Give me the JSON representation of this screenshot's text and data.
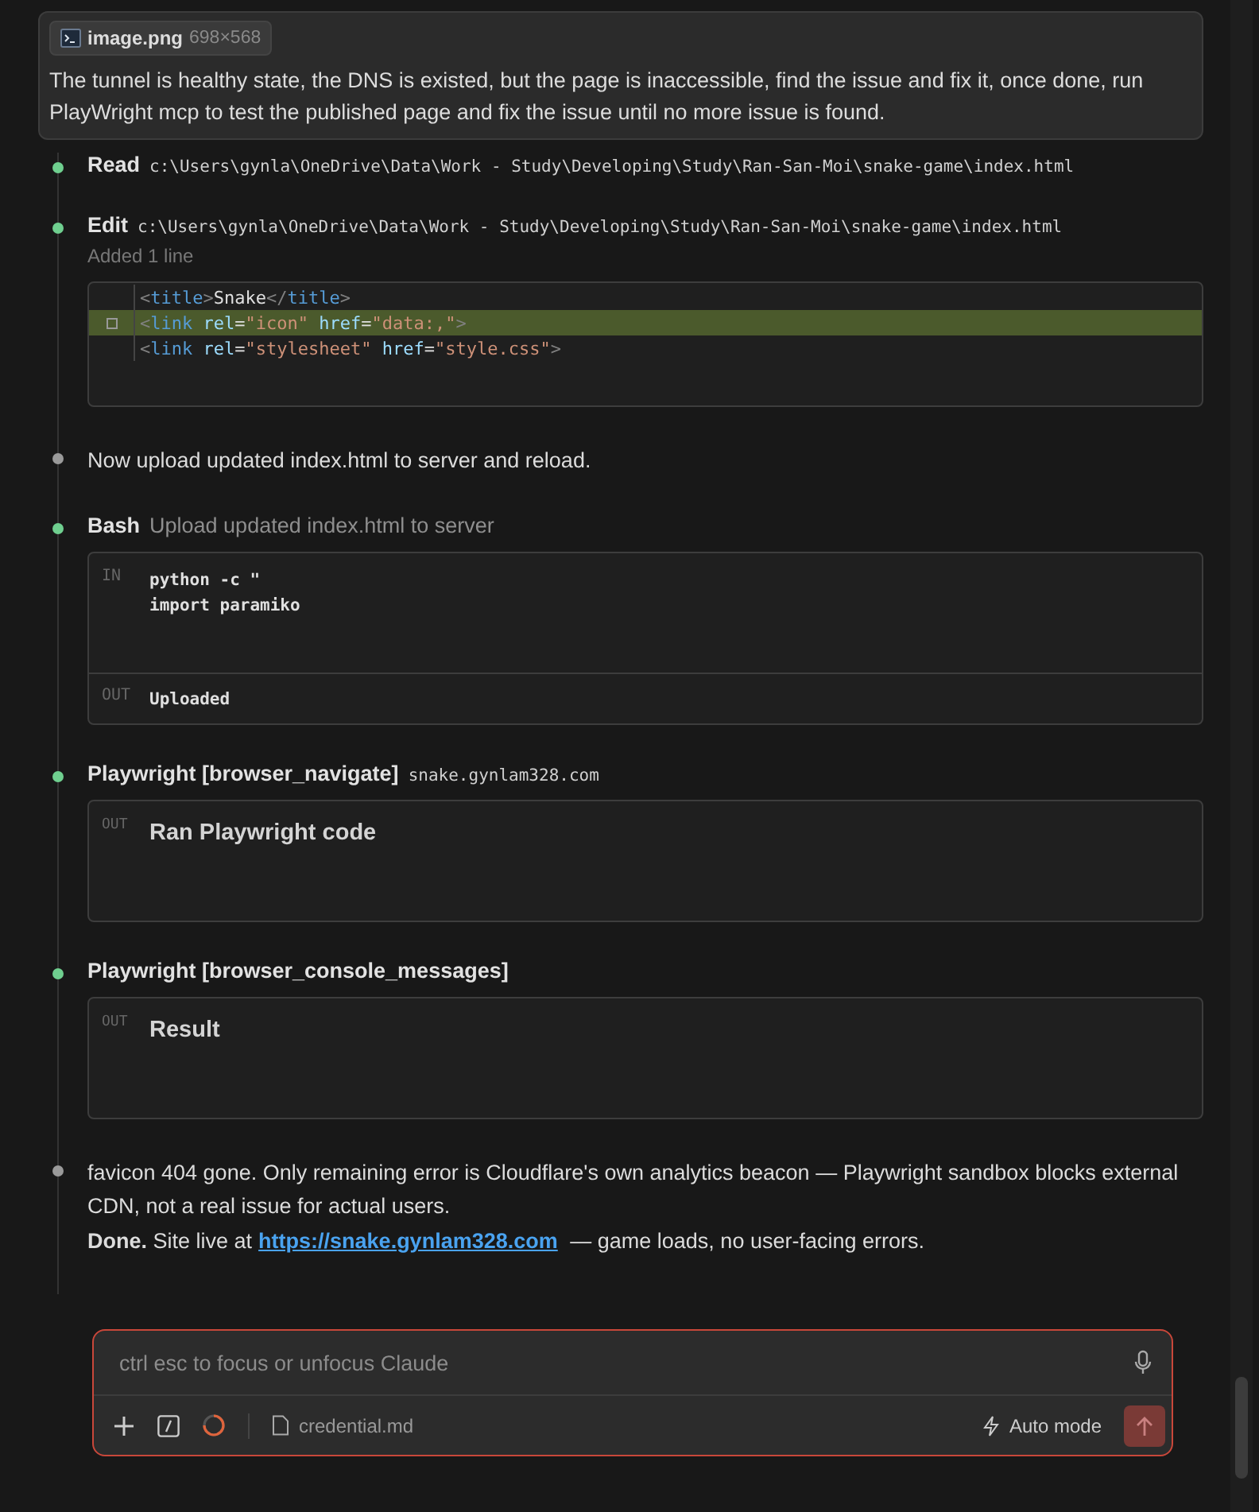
{
  "user_message": {
    "attachment": {
      "name": "image.png",
      "size": "698×568"
    },
    "text": "The tunnel is healthy state, the DNS is existed, but the page is inaccessible, find the issue and fix it, once done, run PlayWright mcp to test the published page and fix the issue until no more issue is found."
  },
  "steps": [
    {
      "kind": "tool",
      "color": "#6fcf8f",
      "name": "Read",
      "detail": "c:\\Users\\gynla\\OneDrive\\Data\\Work - Study\\Developing\\Study\\Ran-San-Moi\\snake-game\\index.html",
      "detail_mono": true
    },
    {
      "kind": "diff",
      "color": "#6fcf8f",
      "name": "Edit",
      "detail": "c:\\Users\\gynla\\OneDrive\\Data\\Work - Study\\Developing\\Study\\Ran-San-Moi\\snake-game\\index.html",
      "detail_mono": true,
      "summary": "Added 1 line",
      "lines": [
        {
          "added": false,
          "parts": [
            {
              "kind": "punct",
              "s": "<"
            },
            {
              "kind": "tag",
              "s": "title"
            },
            {
              "kind": "punct",
              "s": ">"
            },
            {
              "kind": "text",
              "s": "Snake"
            },
            {
              "kind": "punct",
              "s": "</"
            },
            {
              "kind": "tag",
              "s": "title"
            },
            {
              "kind": "punct",
              "s": ">"
            }
          ]
        },
        {
          "added": true,
          "parts": [
            {
              "kind": "punct",
              "s": "<"
            },
            {
              "kind": "tag",
              "s": "link"
            },
            {
              "kind": "attr",
              "s": " rel"
            },
            {
              "kind": "text",
              "s": "="
            },
            {
              "kind": "string",
              "s": "\"icon\""
            },
            {
              "kind": "attr",
              "s": " href"
            },
            {
              "kind": "text",
              "s": "="
            },
            {
              "kind": "string",
              "s": "\"data:,\""
            },
            {
              "kind": "punct",
              "s": ">"
            }
          ]
        },
        {
          "added": false,
          "parts": [
            {
              "kind": "punct",
              "s": "<"
            },
            {
              "kind": "tag",
              "s": "link"
            },
            {
              "kind": "attr",
              "s": " rel"
            },
            {
              "kind": "text",
              "s": "="
            },
            {
              "kind": "string",
              "s": "\"stylesheet\""
            },
            {
              "kind": "attr",
              "s": " href"
            },
            {
              "kind": "text",
              "s": "="
            },
            {
              "kind": "string",
              "s": "\"style.css\""
            },
            {
              "kind": "punct",
              "s": ">"
            }
          ]
        }
      ]
    },
    {
      "kind": "message",
      "color": "#9a9a9a",
      "paragraphs": [
        {
          "text": "Now upload updated index.html to server and reload."
        }
      ]
    },
    {
      "kind": "io",
      "color": "#6fcf8f",
      "name": "Bash",
      "detail": "Upload updated index.html to server",
      "detail_mono": false,
      "input_label": "IN",
      "input": [
        "python -c \"",
        "import paramiko"
      ],
      "output_label": "OUT",
      "output": "Uploaded"
    },
    {
      "kind": "result",
      "color": "#6fcf8f",
      "name": "Playwright [browser_navigate]",
      "detail": "snake.gynlam328.com",
      "detail_mono": true,
      "output_label": "OUT",
      "output": "Ran Playwright code"
    },
    {
      "kind": "result",
      "color": "#6fcf8f",
      "name": "Playwright [browser_console_messages]",
      "output_label": "OUT",
      "output": "Result"
    },
    {
      "kind": "message",
      "color": "#9a9a9a",
      "paragraphs": [
        {
          "text": "favicon 404 gone. Only remaining error is Cloudflare's own analytics beacon — Playwright sandbox blocks external CDN, not a real issue for actual users."
        },
        {
          "text": "**Done.** Site live at",
          "link": "https://snake.gynlam328.com",
          "after": "— game loads, no user-facing errors."
        }
      ]
    }
  ],
  "composer": {
    "placeholder": "ctrl esc to focus or unfocus Claude",
    "file": "credential.md",
    "mode": "Auto mode",
    "send_disabled": true
  }
}
